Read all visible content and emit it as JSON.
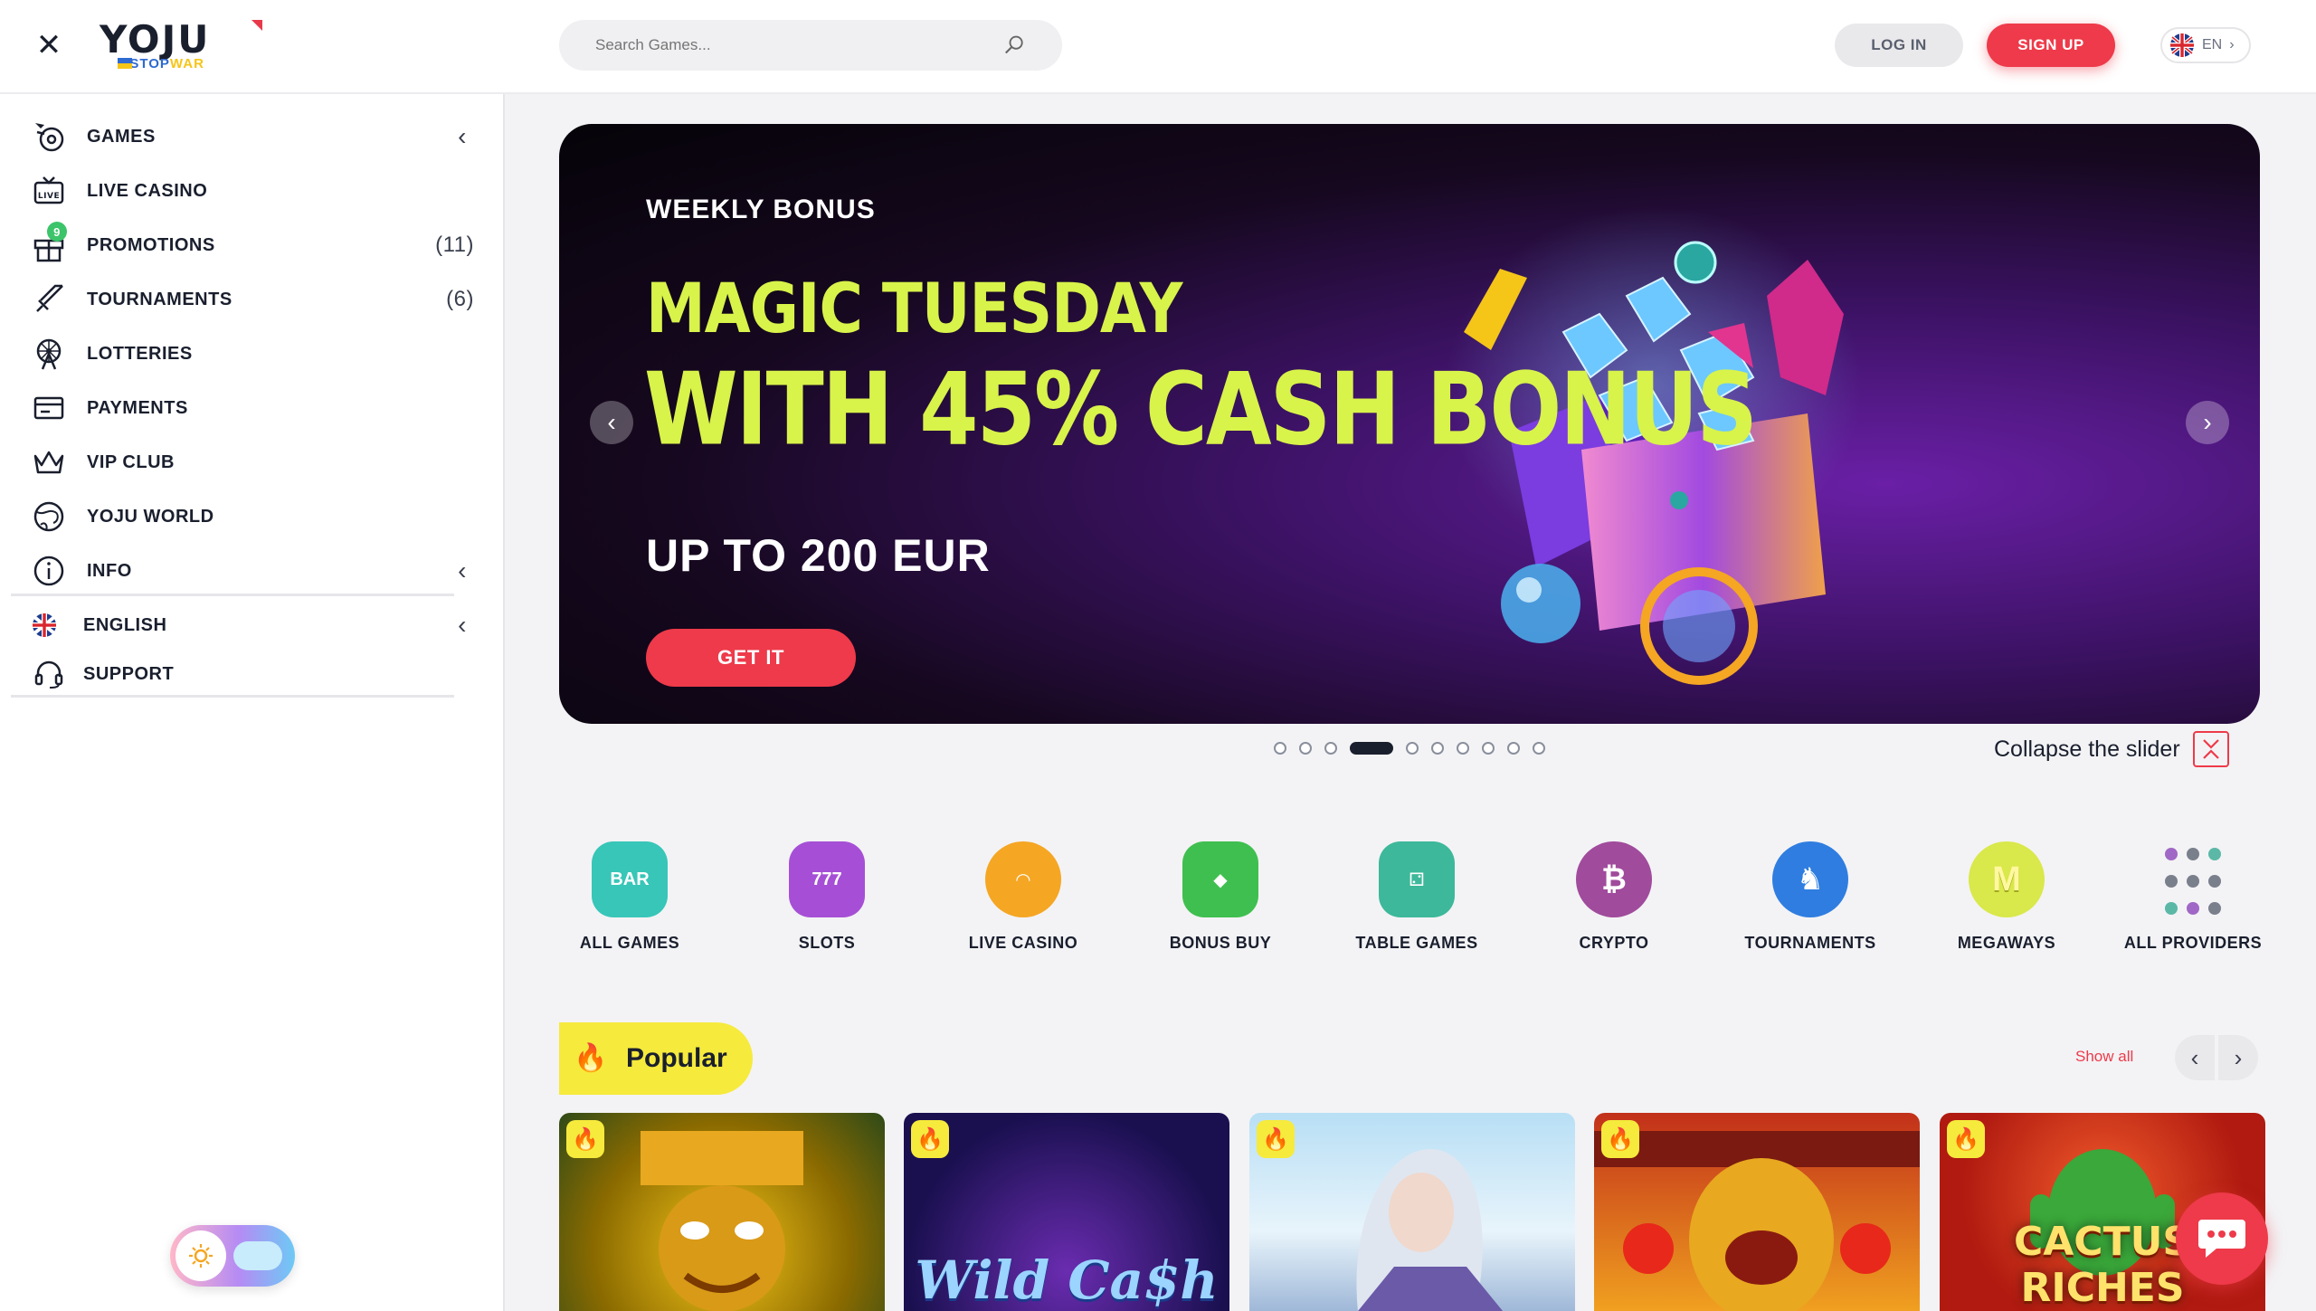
{
  "header": {
    "logo_text": "YOJU",
    "logo_sub_hash": "#STOP",
    "logo_sub_word": "WAR",
    "search_placeholder": "Search Games...",
    "login_label": "LOG IN",
    "signup_label": "SIGN UP",
    "lang_label": "EN",
    "lang_chevron": "›"
  },
  "sidebar": {
    "items": [
      {
        "label": "GAMES",
        "icon": "games-icon",
        "chevron": "‹"
      },
      {
        "label": "LIVE CASINO",
        "icon": "live-casino-icon"
      },
      {
        "label": "PROMOTIONS",
        "icon": "gift-icon",
        "count": "(11)",
        "badge": "9"
      },
      {
        "label": "TOURNAMENTS",
        "icon": "swords-icon",
        "count": "(6)"
      },
      {
        "label": "LOTTERIES",
        "icon": "ferris-wheel-icon"
      },
      {
        "label": "PAYMENTS",
        "icon": "payments-icon"
      },
      {
        "label": "VIP CLUB",
        "icon": "crown-icon"
      },
      {
        "label": "YOJU WORLD",
        "icon": "globe-icon"
      },
      {
        "label": "INFO",
        "icon": "info-icon",
        "chevron": "‹"
      },
      {
        "label": "ENGLISH",
        "icon": "uk-flag-icon",
        "chevron": "‹"
      },
      {
        "label": "SUPPORT",
        "icon": "headset-icon"
      }
    ]
  },
  "hero": {
    "eyebrow": "WEEKLY BONUS",
    "line1": "MAGIC TUESDAY",
    "line2": "WITH 45% CASH BONUS",
    "line3": "UP TO 200 EUR",
    "cta": "GET IT",
    "prev": "‹",
    "next": "›",
    "slides_total": 10,
    "active_slide": 4,
    "collapse_label": "Collapse the slider"
  },
  "categories": [
    {
      "label": "ALL GAMES",
      "icon": "bar-slot-icon",
      "color": "#37c6b8"
    },
    {
      "label": "SLOTS",
      "icon": "slot-machine-icon",
      "color": "#a64fd6"
    },
    {
      "label": "LIVE CASINO",
      "icon": "dealer-icon",
      "color": "#f5a623"
    },
    {
      "label": "BONUS BUY",
      "icon": "diamond-icon",
      "color": "#3fbf4f"
    },
    {
      "label": "TABLE GAMES",
      "icon": "dice-icon",
      "color": "#3db89a"
    },
    {
      "label": "CRYPTO",
      "icon": "bitcoin-icon",
      "color": "#a04b9c"
    },
    {
      "label": "TOURNAMENTS",
      "icon": "trophy-icon",
      "color": "#2f7de0"
    },
    {
      "label": "MEGAWAYS",
      "icon": "megaways-m-icon",
      "color": "#d9e84a"
    },
    {
      "label": "ALL PROVIDERS",
      "icon": "grid-dots-icon"
    }
  ],
  "popular": {
    "title": "Popular",
    "show_all": "Show all",
    "prev": "‹",
    "next": "›",
    "games": [
      {
        "name": "aztec-mask-game",
        "title": ""
      },
      {
        "name": "wild-cash-game",
        "title": "Wild Ca$h"
      },
      {
        "name": "ice-queen-game",
        "title": ""
      },
      {
        "name": "lion-game",
        "title": ""
      },
      {
        "name": "cactus-riches-game",
        "title": "CACTUS RICHES"
      }
    ]
  },
  "colors": {
    "accent": "#ee3a4a",
    "hero_headline": "#d8f34a",
    "popular_tag": "#f6ea3d"
  }
}
